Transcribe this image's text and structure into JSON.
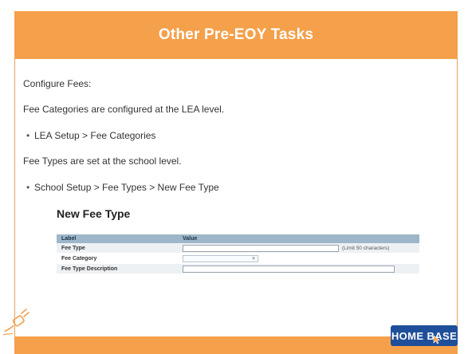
{
  "slide": {
    "title": "Other Pre-EOY Tasks",
    "lines": [
      "Configure Fees:",
      "Fee Categories are configured at the LEA level.",
      "LEA Setup > Fee Categories",
      "Fee Types are set at the school level.",
      "School Setup > Fee Types > New Fee Type"
    ],
    "bullet_symbol": "•"
  },
  "screenshot": {
    "title": "New Fee Type",
    "header": {
      "label": "Label",
      "value": "Value"
    },
    "rows": [
      {
        "label": "Fee Type",
        "hint": "(Limit 50 characters)"
      },
      {
        "label": "Fee Category"
      },
      {
        "label": "Fee Type Description"
      }
    ]
  },
  "logo": {
    "text": "HOME BASE"
  },
  "colors": {
    "accent": "#f5a04a",
    "logo": "#1f4f9a",
    "table_header": "#9db6c9"
  },
  "icons": {
    "plug": "plug-icon",
    "cursor": "cursor-icon"
  }
}
